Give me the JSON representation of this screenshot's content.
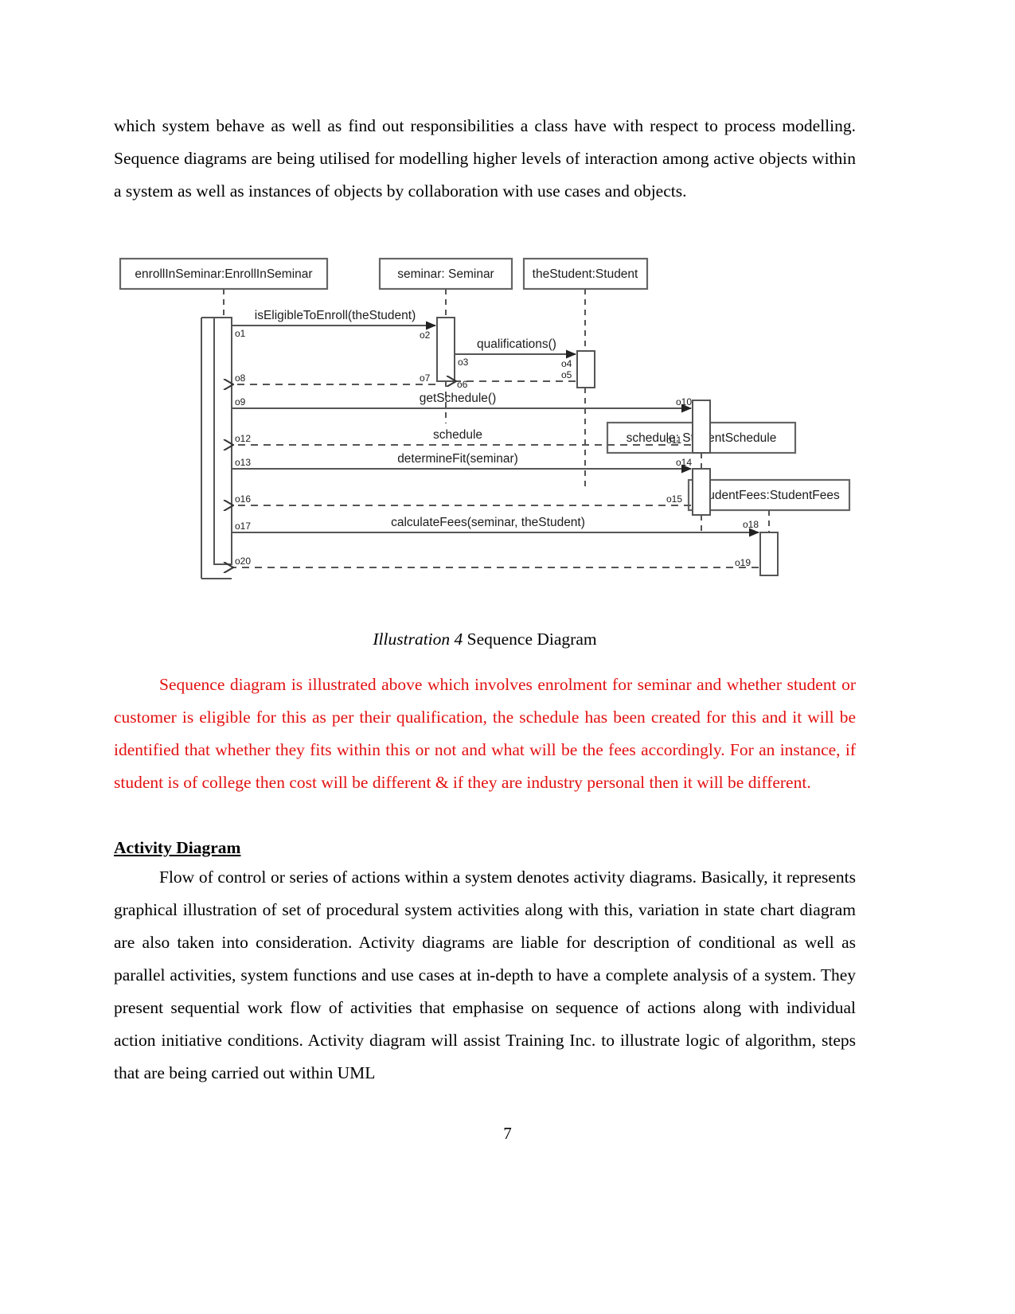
{
  "document": {
    "page_number": "7",
    "paragraph_top": "which system behave as well as find out responsibilities a class have with respect to process modelling. Sequence diagrams are being utilised for modelling higher levels of interaction among active objects within a system as well as instances of objects by collaboration with use cases and objects.",
    "caption": {
      "label": "Illustration 4",
      "text": " Sequence Diagram"
    },
    "paragraph_red": "Sequence diagram is illustrated above which involves enrolment for seminar and whether student or customer is eligible for this as per their qualification, the schedule has been created for this and it will be identified that whether they fits within this or not and what will be the fees accordingly. For an instance, if student is of college then cost will be different & if they are industry personal then it will be different.",
    "heading_activity": "Activity Diagram",
    "paragraph_activity": "Flow of control or series of actions within a system denotes activity diagrams. Basically, it represents graphical illustration of set of procedural system activities along with this, variation in state chart diagram are also taken into consideration. Activity diagrams are liable for description of conditional as well as parallel activities, system functions and use cases at in-depth to have a complete analysis of a system. They present sequential work flow of activities that emphasise on sequence of actions along with individual action initiative conditions. Activity diagram will assist Training Inc. to illustrate logic of algorithm, steps that are being carried out within UML",
    "colors": {
      "body_text": "#000000",
      "highlight_text": "#e31111",
      "diagram_line": "#555555"
    }
  },
  "diagram": {
    "type": "uml-sequence-diagram",
    "lifelines": [
      {
        "id": "enroll",
        "label": "enrollInSeminar:EnrollInSeminar"
      },
      {
        "id": "seminar",
        "label": "seminar: Seminar"
      },
      {
        "id": "student",
        "label": "theStudent:Student"
      },
      {
        "id": "schedule",
        "label": "schedule: StudentSchedule"
      },
      {
        "id": "fees",
        "label": "studentFees:StudentFees"
      }
    ],
    "messages": [
      {
        "seq_from": "o1",
        "seq_to": "o2",
        "label": "isEligibleToEnroll(theStudent)",
        "from": "enroll",
        "to": "seminar",
        "kind": "call"
      },
      {
        "seq_from": "o3",
        "seq_to": "o4",
        "label": "qualifications()",
        "from": "seminar",
        "to": "student",
        "kind": "call"
      },
      {
        "seq_from": "o5",
        "seq_to": "o6",
        "label": "",
        "from": "student",
        "to": "seminar",
        "kind": "return"
      },
      {
        "seq_from": "o7",
        "seq_to": "o8",
        "label": "",
        "from": "seminar",
        "to": "enroll",
        "kind": "return"
      },
      {
        "seq_from": "o9",
        "seq_to": "o10",
        "label": "getSchedule()",
        "from": "enroll",
        "to": "schedule",
        "kind": "call"
      },
      {
        "seq_from": "o11",
        "seq_to": "o12",
        "label": "schedule",
        "from": "schedule",
        "to": "enroll",
        "kind": "return"
      },
      {
        "seq_from": "o13",
        "seq_to": "o14",
        "label": "determineFit(seminar)",
        "from": "enroll",
        "to": "schedule",
        "kind": "call"
      },
      {
        "seq_from": "o15",
        "seq_to": "o16",
        "label": "",
        "from": "schedule",
        "to": "enroll",
        "kind": "return"
      },
      {
        "seq_from": "o17",
        "seq_to": "o18",
        "label": "calculateFees(seminar, theStudent)",
        "from": "enroll",
        "to": "fees",
        "kind": "call"
      },
      {
        "seq_from": "o19",
        "seq_to": "o20",
        "label": "",
        "from": "fees",
        "to": "enroll",
        "kind": "return"
      }
    ],
    "sequence_labels": [
      "o1",
      "o2",
      "o3",
      "o4",
      "o5",
      "o6",
      "o7",
      "o8",
      "o9",
      "o10",
      "o11",
      "o12",
      "o13",
      "o14",
      "o15",
      "o16",
      "o17",
      "o18",
      "o19",
      "o20"
    ]
  }
}
